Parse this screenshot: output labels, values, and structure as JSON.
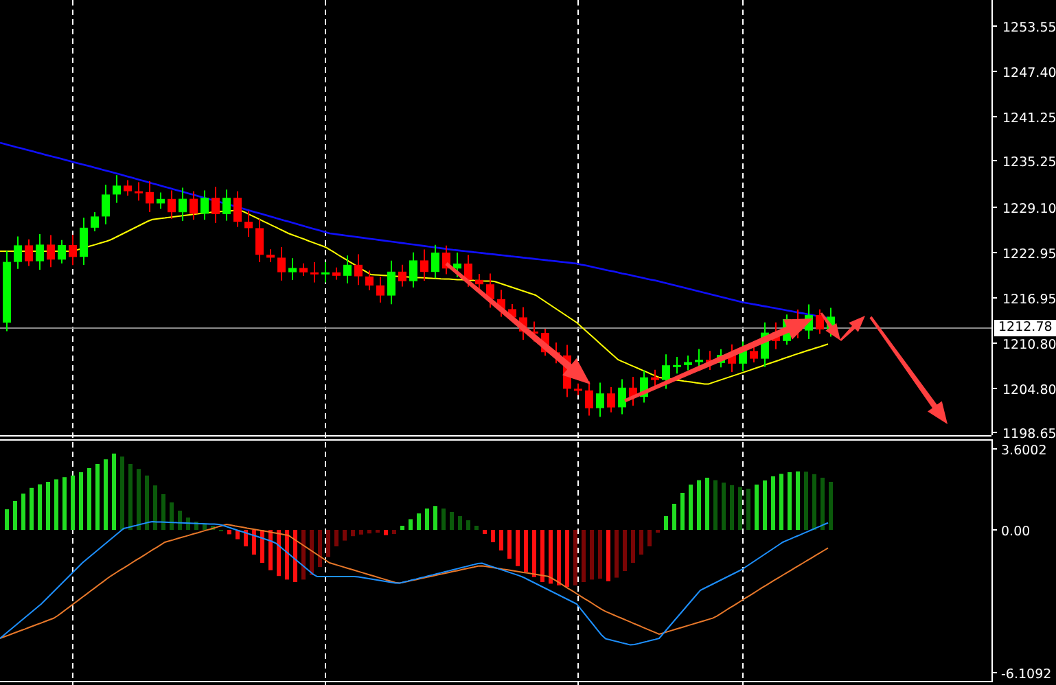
{
  "price_axis": {
    "labels": [
      "1253.55",
      "1247.40",
      "1241.25",
      "1235.25",
      "1229.10",
      "1222.95",
      "1216.95",
      "1210.80",
      "1204.80",
      "1198.65"
    ],
    "current_price": "1212.78"
  },
  "indicator_axis": {
    "labels": [
      "3.6002",
      "0.00",
      "-6.1092"
    ]
  }
}
